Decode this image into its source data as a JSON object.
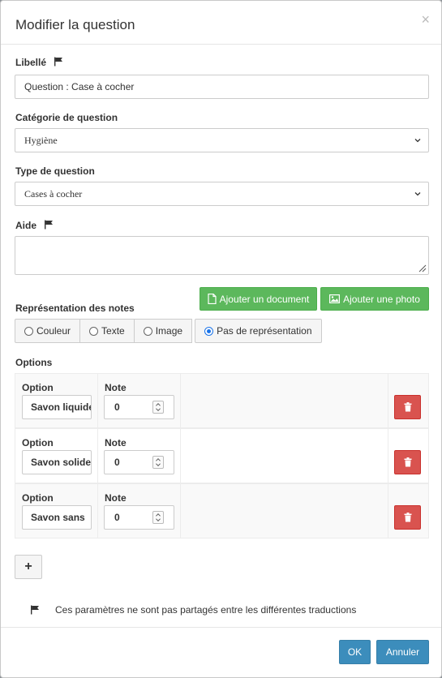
{
  "modal": {
    "title": "Modifier la question",
    "close_label": "×"
  },
  "fields": {
    "libelle_label": "Libellé",
    "libelle_value": "Question : Case à cocher",
    "categorie_label": "Catégorie de question",
    "categorie_value": "Hygiène",
    "type_label": "Type de question",
    "type_value": "Cases à cocher",
    "aide_label": "Aide",
    "aide_value": ""
  },
  "buttons": {
    "add_document": "Ajouter un document",
    "add_photo": "Ajouter une photo",
    "add_option": "+",
    "ok": "OK",
    "cancel": "Annuler"
  },
  "representation": {
    "label": "Représentation des notes",
    "options": [
      {
        "label": "Couleur",
        "checked": false
      },
      {
        "label": "Texte",
        "checked": false
      },
      {
        "label": "Image",
        "checked": false
      },
      {
        "label": "Pas de représentation",
        "checked": true
      }
    ]
  },
  "options": {
    "label": "Options",
    "option_col": "Option",
    "note_col": "Note",
    "rows": [
      {
        "option": "Savon liquide",
        "note": "0"
      },
      {
        "option": "Savon solide",
        "note": "0"
      },
      {
        "option": "Savon sans",
        "note": "0"
      }
    ]
  },
  "footer_note": "Ces paramètres ne sont pas partagés entre les différentes traductions",
  "colors": {
    "green": "#5cb85c",
    "red": "#d9534f",
    "blue": "#3c8dbc"
  }
}
